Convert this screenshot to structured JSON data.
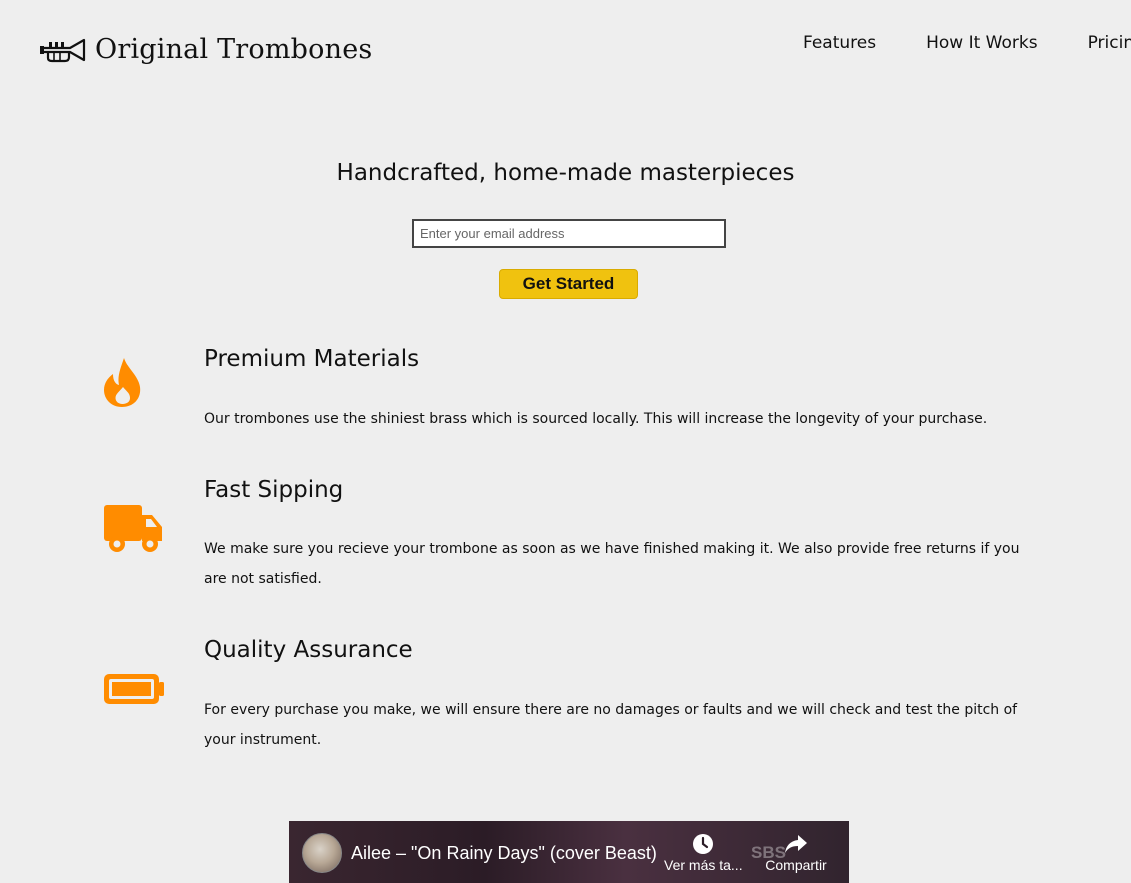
{
  "brand": {
    "name": "Original Trombones",
    "logo_icon": "trumpet-icon"
  },
  "nav": {
    "items": [
      {
        "label": "Features"
      },
      {
        "label": "How It Works"
      },
      {
        "label": "Pricing"
      }
    ]
  },
  "hero": {
    "title": "Handcrafted, home-made masterpieces",
    "email_placeholder": "Enter your email address",
    "cta_label": "Get Started"
  },
  "features": [
    {
      "icon": "fire-icon",
      "title": "Premium Materials",
      "description": "Our trombones use the shiniest brass which is sourced locally. This will increase the longevity of your purchase."
    },
    {
      "icon": "truck-icon",
      "title": "Fast Sipping",
      "description": "We make sure you recieve your trombone as soon as we have finished making it. We also provide free returns if you are not satisfied."
    },
    {
      "icon": "battery-icon",
      "title": "Quality Assurance",
      "description": "For every purchase you make, we will ensure there are no damages or faults and we will check and test the pitch of your instrument."
    }
  ],
  "video": {
    "title": "Ailee – \"On Rainy Days\" (cover Beast)",
    "watch_later_label": "Ver más ta...",
    "share_label": "Compartir",
    "channel_mark": "SBS"
  },
  "colors": {
    "background": "#eeeeee",
    "accent": "#ff8c00",
    "cta": "#f0c20f"
  }
}
